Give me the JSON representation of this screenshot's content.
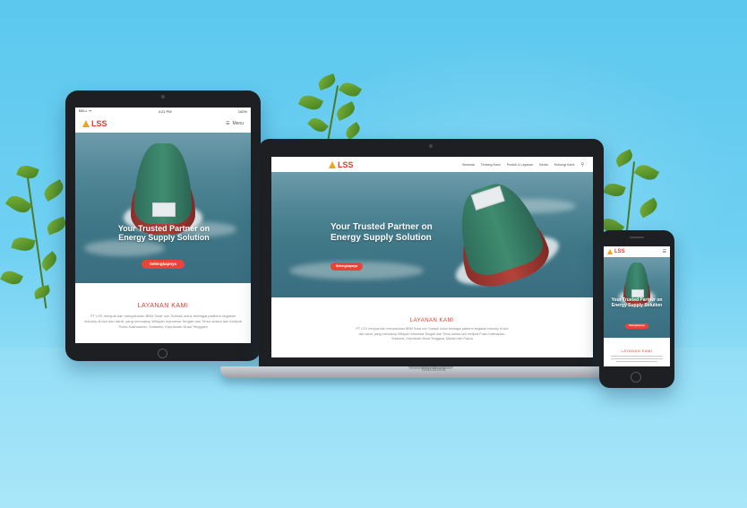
{
  "brand": {
    "logo_text": "LSS"
  },
  "tablet": {
    "status_carrier": "BELL ᯤ",
    "status_time": "4:21 PM",
    "status_battery": "100%",
    "menu_label": "Menu",
    "hero_title": "Your Trusted Partner on Energy Supply Solution",
    "cta_label": "Selengkapnya",
    "section_title": "LAYANAN KAMI",
    "section_text": "PT LSS menjual dan menyalurkan BBM Solar non Subsidi untuk berbagai platform kegiatan industry di laut dan darat, yang mencakup Wilayah Indonesia Tengah dan Timur antara lain meliputi Pulau Kalimantan, Sulawesi, Kepulauan Nusa Tenggara"
  },
  "laptop": {
    "nav_links": [
      "Beranda",
      "Tentang Kami",
      "Produk & Layanan",
      "Berita",
      "Hubungi Kami"
    ],
    "hero_title": "Your Trusted Partner on Energy Supply Solution",
    "cta_label": "Selengkapnya",
    "section_title": "LAYANAN KAMI",
    "section_text": "PT LSS menjual dan menyalurkan BBM Solar non Subsidi untuk berbagai platform kegiatan industry di laut dan darat, yang mencakup Wilayah Indonesia Tengah dan Timur antara lain meliputi Pulau Kalimantan, Sulawesi, Kepulauan Nusa Tenggara, Maluku dan Papua",
    "base_label": "MacBook"
  },
  "phone": {
    "hero_title": "Your Trusted Partner on Energy Supply Solution",
    "cta_label": "Selengkapnya",
    "section_title": "LAYANAN KAMI"
  },
  "colors": {
    "accent": "#e8443a",
    "brand_red": "#e23b2c",
    "brand_orange": "#f0a21c",
    "background": "#6fd0f2"
  }
}
